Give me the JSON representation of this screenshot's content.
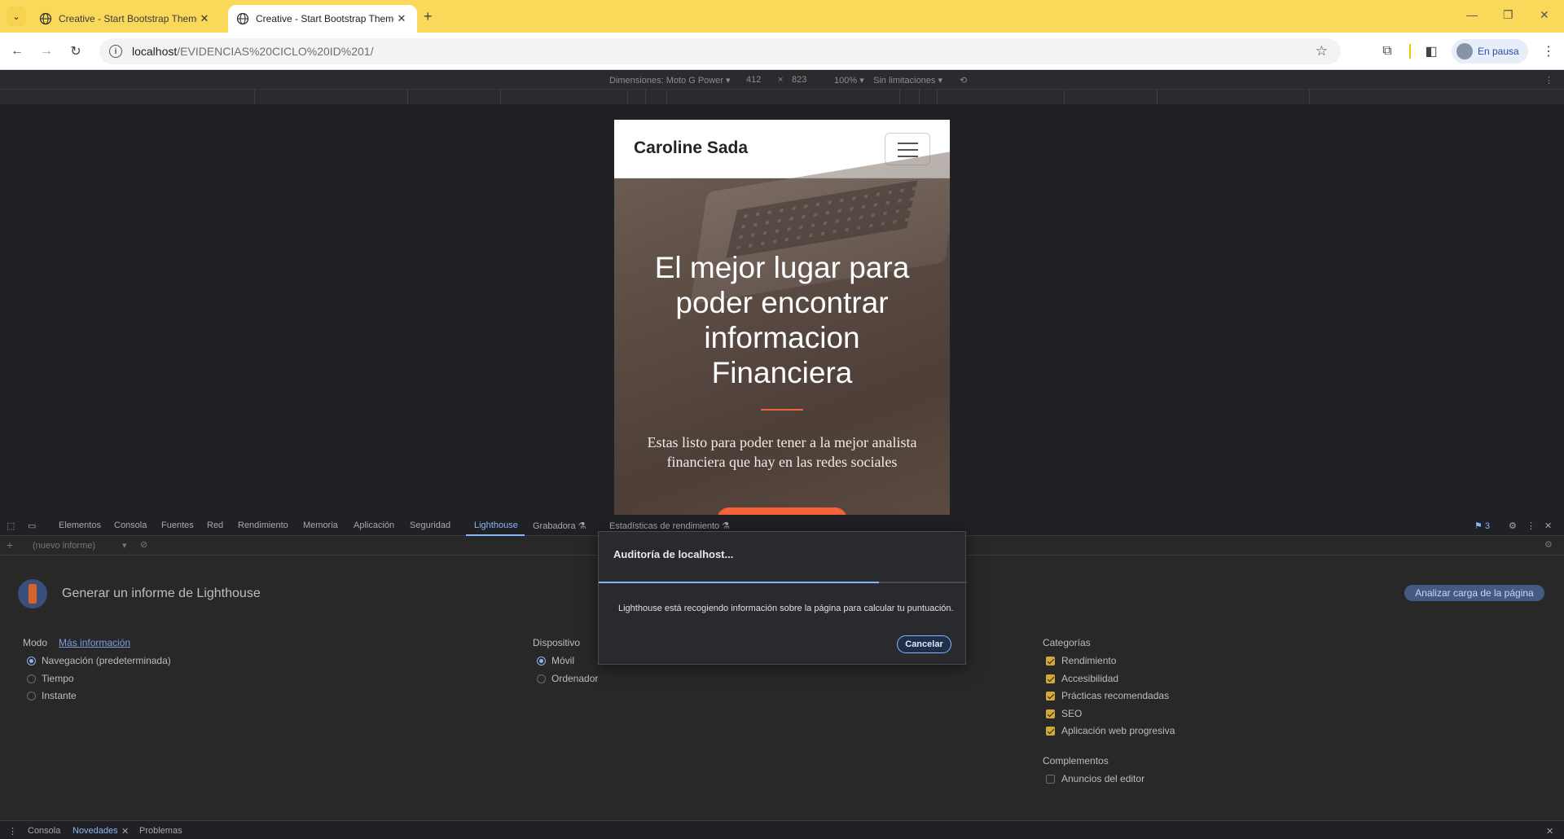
{
  "browser": {
    "tabs": [
      {
        "title": "Creative - Start Bootstrap Theme",
        "active": false
      },
      {
        "title": "Creative - Start Bootstrap Theme",
        "active": true
      }
    ],
    "url_host": "localhost",
    "url_path": "/EVIDENCIAS%20CICLO%20ID%201/",
    "profile_label": "En pausa",
    "icons": [
      "tab-list-icon",
      "globe-icon",
      "close-icon",
      "new-tab-icon",
      "minimize-icon",
      "maximize-icon",
      "back-icon",
      "forward-icon",
      "reload-icon",
      "info-icon",
      "star-icon",
      "extensions-icon",
      "side-panel-icon",
      "kebab-menu-icon"
    ]
  },
  "device_toolbar": {
    "dimensions_label": "Dimensiones: Moto G Power ▾",
    "width": "412",
    "times": "×",
    "height": "823",
    "zoom": "100% ▾",
    "throttle": "Sin limitaciones ▾"
  },
  "site": {
    "brand": "Caroline Sada",
    "hero_title": "El mejor lugar para poder encontrar informacion Financiera",
    "hero_text": "Estas listo para poder tener a la mejor analista financiera que hay en las redes sociales",
    "accent_color": "#f4623a"
  },
  "devtools": {
    "tabs": [
      "Elementos",
      "Consola",
      "Fuentes",
      "Red",
      "Rendimiento",
      "Memoria",
      "Aplicación",
      "Seguridad",
      "Lighthouse",
      "Grabadora ⚗",
      "Estadísticas de rendimiento ⚗"
    ],
    "active_tab": "Lighthouse",
    "issues_count": "3",
    "report_select": "(nuevo informe)",
    "lighthouse": {
      "title": "Generar un informe de Lighthouse",
      "analyze_button": "Analizar carga de la página",
      "mode_label": "Modo",
      "mode_link": "Más información",
      "modes": [
        "Navegación (predeterminada)",
        "Tiempo",
        "Instante"
      ],
      "mode_selected": "Navegación (predeterminada)",
      "device_label": "Dispositivo",
      "devices": [
        "Móvil",
        "Ordenador"
      ],
      "device_selected": "Móvil",
      "categories_label": "Categorías",
      "categories": [
        "Rendimiento",
        "Accesibilidad",
        "Prácticas recomendadas",
        "SEO",
        "Aplicación web progresiva"
      ],
      "plugins_label": "Complementos",
      "plugins": [
        "Anuncios del editor"
      ]
    },
    "dialog": {
      "title": "Auditoría de localhost...",
      "progress": 0.76,
      "message": "Lighthouse está recogiendo información sobre la página para calcular tu puntuación.",
      "cancel": "Cancelar"
    },
    "drawer_tabs": [
      "Consola",
      "Novedades",
      "Problemas"
    ],
    "drawer_active": "Novedades"
  }
}
